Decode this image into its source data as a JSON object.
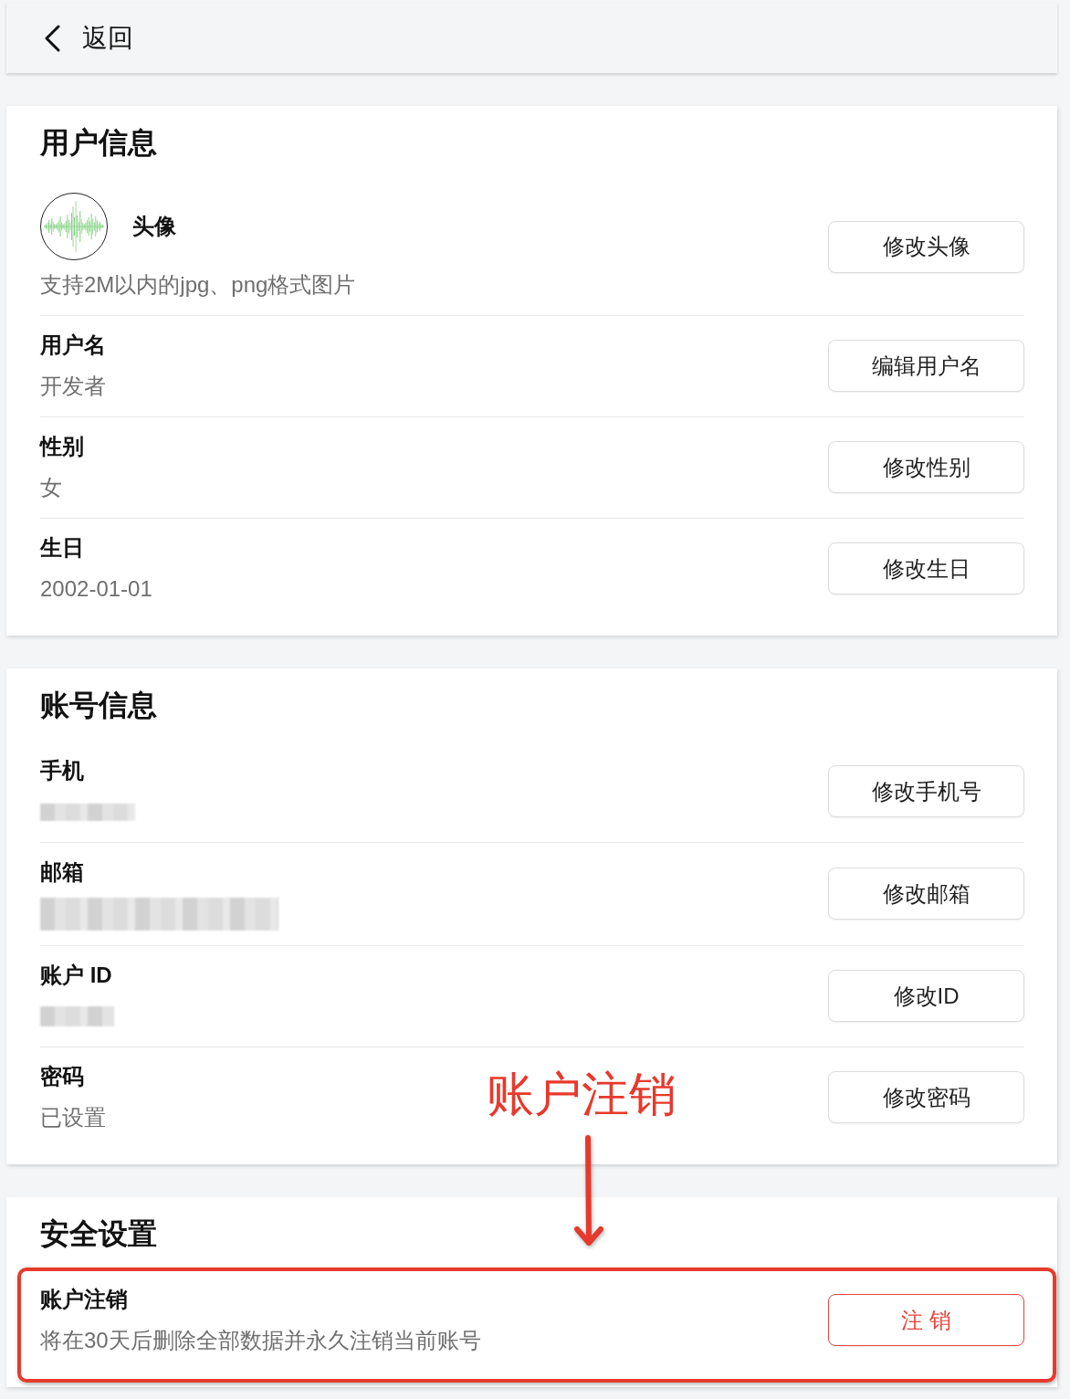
{
  "header": {
    "back_label": "返回"
  },
  "sections": [
    {
      "title": "用户信息",
      "rows": [
        {
          "kind": "avatar",
          "label": "头像",
          "value": "支持2M以内的jpg、png格式图片",
          "button": "修改头像",
          "highlighted": false
        },
        {
          "kind": "text",
          "label": "用户名",
          "value": "开发者",
          "button": "编辑用户名",
          "highlighted": false
        },
        {
          "kind": "text",
          "label": "性别",
          "value": "女",
          "button": "修改性别",
          "highlighted": false
        },
        {
          "kind": "text",
          "label": "生日",
          "value": "2002-01-01",
          "button": "修改生日",
          "highlighted": false
        }
      ]
    },
    {
      "title": "账号信息",
      "rows": [
        {
          "kind": "redacted",
          "label": "手机",
          "button": "修改手机号",
          "highlighted": false
        },
        {
          "kind": "redacted",
          "label": "邮箱",
          "button": "修改邮箱",
          "highlighted": false
        },
        {
          "kind": "redacted",
          "label": "账户 ID",
          "button": "修改ID",
          "highlighted": false
        },
        {
          "kind": "text",
          "label": "密码",
          "value": "已设置",
          "button": "修改密码",
          "highlighted": false
        }
      ]
    },
    {
      "title": "安全设置",
      "rows": [
        {
          "kind": "danger",
          "label": "账户注销",
          "value": "将在30天后删除全部数据并永久注销当前账号",
          "button": "注 销",
          "highlighted": true
        }
      ]
    }
  ],
  "annotation": {
    "label": "账户注销"
  }
}
